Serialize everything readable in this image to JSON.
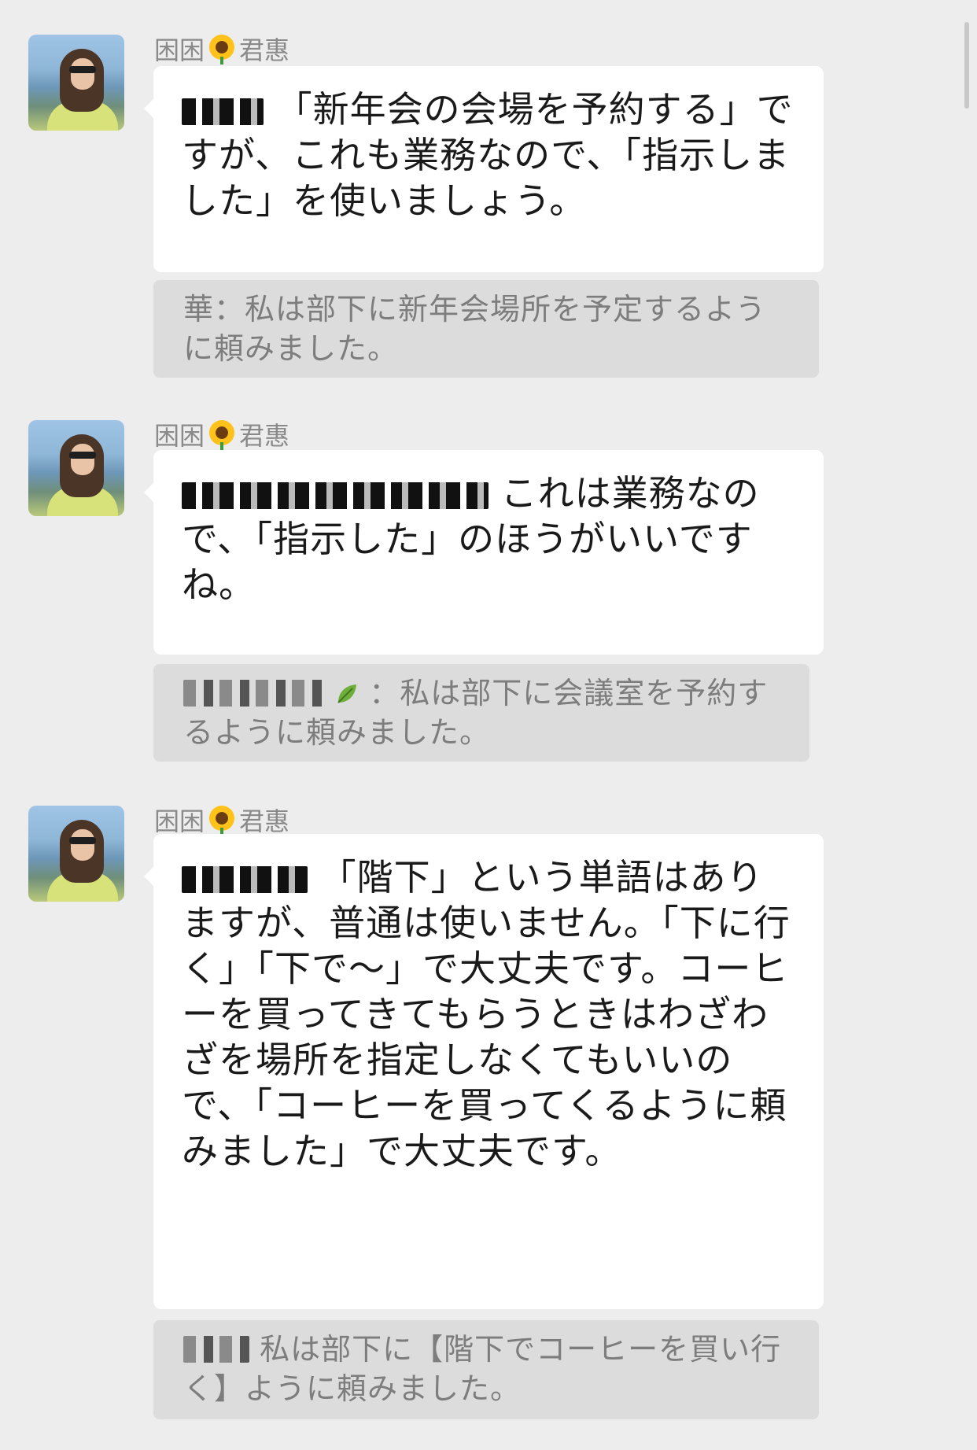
{
  "messages": [
    {
      "sender": {
        "name_before": "困困",
        "icon": "sunflower-icon",
        "name_after": "君惠"
      },
      "text_prefix": "",
      "text": "「新年会の会場を予約する」ですが、これも業務なので、「指示しました」を使いましょう。",
      "quote_prefix": "",
      "quote": "華：私は部下に新年会場所を予定するように頼みました。"
    },
    {
      "sender": {
        "name_before": "困困",
        "icon": "sunflower-icon",
        "name_after": "君惠"
      },
      "text": "これは業務なので、「指示した」のほうがいいですね。",
      "quote": "：私は部下に会議室を予約するように頼みました。"
    },
    {
      "sender": {
        "name_before": "困困",
        "icon": "sunflower-icon",
        "name_after": "君惠"
      },
      "text": "「階下」という単語はありますが、普通は使いません。「下に行く」「下で～」で大丈夫です。コーヒーを買ってきてもらうときはわざわざを場所を指定しなくてもいいので、「コーヒーを買ってくるように頼みました」で大丈夫です。",
      "quote": "私は部下に【階下でコーヒーを買い行く】ように頼みました。"
    }
  ],
  "colors": {
    "background": "#ededed",
    "bubble": "#ffffff",
    "quote_bg": "#dcdcdc",
    "sender_text": "#8a8a8a",
    "quote_text": "#7d7d7d"
  }
}
